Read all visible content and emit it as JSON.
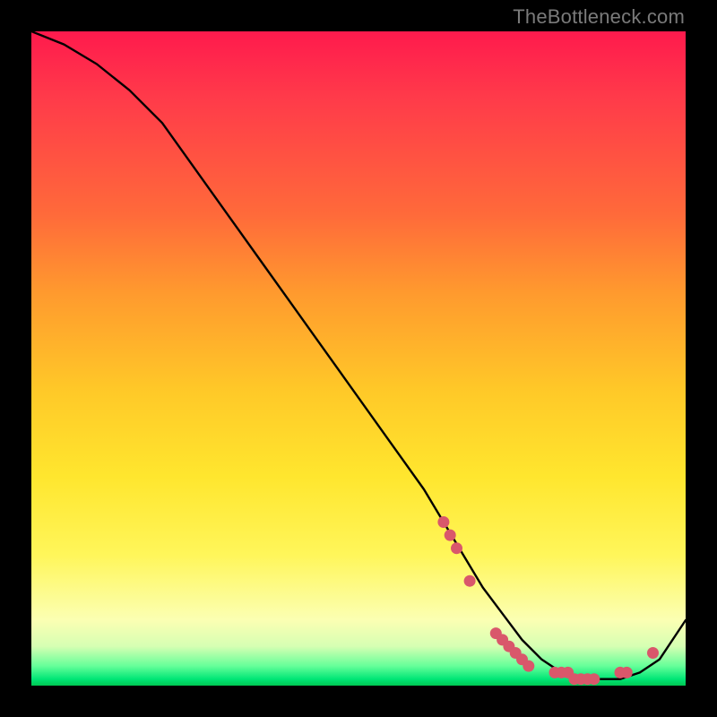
{
  "watermark": "TheBottleneck.com",
  "chart_data": {
    "type": "line",
    "title": "",
    "xlabel": "",
    "ylabel": "",
    "xlim": [
      0,
      100
    ],
    "ylim": [
      0,
      100
    ],
    "series": [
      {
        "name": "curve",
        "x": [
          0,
          5,
          10,
          15,
          20,
          25,
          30,
          35,
          40,
          45,
          50,
          55,
          60,
          63,
          66,
          69,
          72,
          75,
          78,
          81,
          84,
          87,
          90,
          93,
          96,
          100
        ],
        "y": [
          100,
          98,
          95,
          91,
          86,
          79,
          72,
          65,
          58,
          51,
          44,
          37,
          30,
          25,
          20,
          15,
          11,
          7,
          4,
          2,
          1,
          1,
          1,
          2,
          4,
          10
        ]
      }
    ],
    "markers": {
      "name": "highlight-points",
      "color": "#d9576b",
      "x": [
        63,
        64,
        65,
        67,
        71,
        72,
        73,
        74,
        75,
        76,
        80,
        81,
        82,
        83,
        84,
        85,
        86,
        90,
        91,
        95
      ],
      "y": [
        25,
        23,
        21,
        16,
        8,
        7,
        6,
        5,
        4,
        3,
        2,
        2,
        2,
        1,
        1,
        1,
        1,
        2,
        2,
        5
      ]
    },
    "gradient_stops": [
      {
        "pos": 0,
        "color": "#ff1a4d"
      },
      {
        "pos": 28,
        "color": "#ff6a3a"
      },
      {
        "pos": 55,
        "color": "#ffc928"
      },
      {
        "pos": 80,
        "color": "#fff65a"
      },
      {
        "pos": 94,
        "color": "#d6ffb3"
      },
      {
        "pos": 100,
        "color": "#00c853"
      }
    ]
  }
}
